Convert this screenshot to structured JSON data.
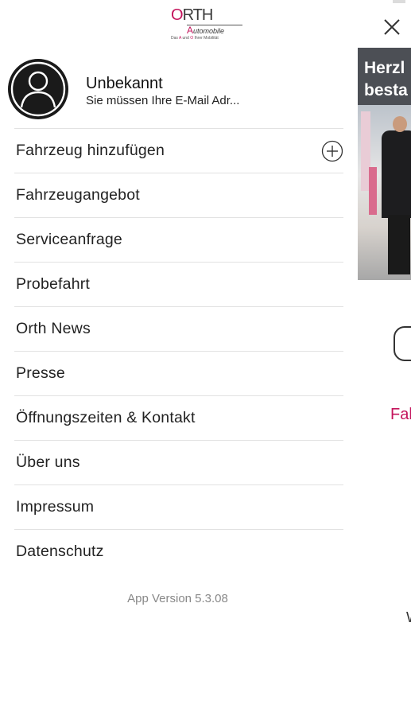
{
  "logo": {
    "brand_first": "O",
    "brand_rest": "RTH",
    "sub_first": "A",
    "sub_rest": "utomobile",
    "tagline_pre": "Das ",
    "tagline_a": "A",
    "tagline_mid": " und ",
    "tagline_o": "O",
    "tagline_post": " Ihrer Mobilität"
  },
  "profile": {
    "name": "Unbekannt",
    "subtitle": "Sie müssen Ihre E-Mail Adr..."
  },
  "menu": {
    "items": [
      {
        "label": "Fahrzeug hinzufügen",
        "icon": "plus-circle-icon"
      },
      {
        "label": "Fahrzeugangebot"
      },
      {
        "label": "Serviceanfrage"
      },
      {
        "label": "Probefahrt"
      },
      {
        "label": "Orth News"
      },
      {
        "label": "Presse"
      },
      {
        "label": "Öffnungszeiten & Kontakt"
      },
      {
        "label": "Über uns"
      },
      {
        "label": "Impressum"
      },
      {
        "label": "Datenschutz"
      }
    ]
  },
  "version": "App Version 5.3.08",
  "background_screen": {
    "hero_line1": "Herzl",
    "hero_line2": "besta",
    "link_text": "Fal",
    "mark": "W"
  },
  "colors": {
    "accent": "#c4145c",
    "divider": "#e2e2e2",
    "text": "#222222",
    "muted": "#888888"
  }
}
